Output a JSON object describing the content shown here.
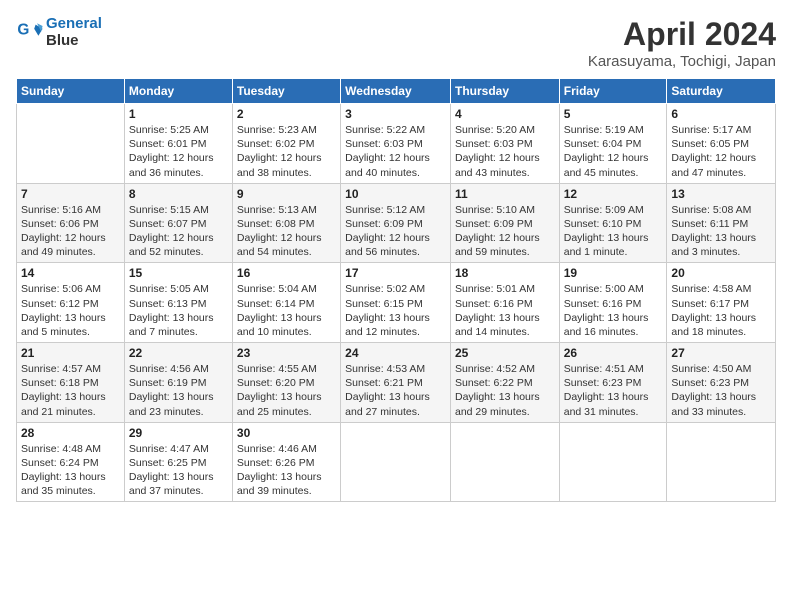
{
  "header": {
    "logo_line1": "General",
    "logo_line2": "Blue",
    "title": "April 2024",
    "subtitle": "Karasuyama, Tochigi, Japan"
  },
  "days_of_week": [
    "Sunday",
    "Monday",
    "Tuesday",
    "Wednesday",
    "Thursday",
    "Friday",
    "Saturday"
  ],
  "weeks": [
    [
      {
        "day": "",
        "info": ""
      },
      {
        "day": "1",
        "info": "Sunrise: 5:25 AM\nSunset: 6:01 PM\nDaylight: 12 hours\nand 36 minutes."
      },
      {
        "day": "2",
        "info": "Sunrise: 5:23 AM\nSunset: 6:02 PM\nDaylight: 12 hours\nand 38 minutes."
      },
      {
        "day": "3",
        "info": "Sunrise: 5:22 AM\nSunset: 6:03 PM\nDaylight: 12 hours\nand 40 minutes."
      },
      {
        "day": "4",
        "info": "Sunrise: 5:20 AM\nSunset: 6:03 PM\nDaylight: 12 hours\nand 43 minutes."
      },
      {
        "day": "5",
        "info": "Sunrise: 5:19 AM\nSunset: 6:04 PM\nDaylight: 12 hours\nand 45 minutes."
      },
      {
        "day": "6",
        "info": "Sunrise: 5:17 AM\nSunset: 6:05 PM\nDaylight: 12 hours\nand 47 minutes."
      }
    ],
    [
      {
        "day": "7",
        "info": "Sunrise: 5:16 AM\nSunset: 6:06 PM\nDaylight: 12 hours\nand 49 minutes."
      },
      {
        "day": "8",
        "info": "Sunrise: 5:15 AM\nSunset: 6:07 PM\nDaylight: 12 hours\nand 52 minutes."
      },
      {
        "day": "9",
        "info": "Sunrise: 5:13 AM\nSunset: 6:08 PM\nDaylight: 12 hours\nand 54 minutes."
      },
      {
        "day": "10",
        "info": "Sunrise: 5:12 AM\nSunset: 6:09 PM\nDaylight: 12 hours\nand 56 minutes."
      },
      {
        "day": "11",
        "info": "Sunrise: 5:10 AM\nSunset: 6:09 PM\nDaylight: 12 hours\nand 59 minutes."
      },
      {
        "day": "12",
        "info": "Sunrise: 5:09 AM\nSunset: 6:10 PM\nDaylight: 13 hours\nand 1 minute."
      },
      {
        "day": "13",
        "info": "Sunrise: 5:08 AM\nSunset: 6:11 PM\nDaylight: 13 hours\nand 3 minutes."
      }
    ],
    [
      {
        "day": "14",
        "info": "Sunrise: 5:06 AM\nSunset: 6:12 PM\nDaylight: 13 hours\nand 5 minutes."
      },
      {
        "day": "15",
        "info": "Sunrise: 5:05 AM\nSunset: 6:13 PM\nDaylight: 13 hours\nand 7 minutes."
      },
      {
        "day": "16",
        "info": "Sunrise: 5:04 AM\nSunset: 6:14 PM\nDaylight: 13 hours\nand 10 minutes."
      },
      {
        "day": "17",
        "info": "Sunrise: 5:02 AM\nSunset: 6:15 PM\nDaylight: 13 hours\nand 12 minutes."
      },
      {
        "day": "18",
        "info": "Sunrise: 5:01 AM\nSunset: 6:16 PM\nDaylight: 13 hours\nand 14 minutes."
      },
      {
        "day": "19",
        "info": "Sunrise: 5:00 AM\nSunset: 6:16 PM\nDaylight: 13 hours\nand 16 minutes."
      },
      {
        "day": "20",
        "info": "Sunrise: 4:58 AM\nSunset: 6:17 PM\nDaylight: 13 hours\nand 18 minutes."
      }
    ],
    [
      {
        "day": "21",
        "info": "Sunrise: 4:57 AM\nSunset: 6:18 PM\nDaylight: 13 hours\nand 21 minutes."
      },
      {
        "day": "22",
        "info": "Sunrise: 4:56 AM\nSunset: 6:19 PM\nDaylight: 13 hours\nand 23 minutes."
      },
      {
        "day": "23",
        "info": "Sunrise: 4:55 AM\nSunset: 6:20 PM\nDaylight: 13 hours\nand 25 minutes."
      },
      {
        "day": "24",
        "info": "Sunrise: 4:53 AM\nSunset: 6:21 PM\nDaylight: 13 hours\nand 27 minutes."
      },
      {
        "day": "25",
        "info": "Sunrise: 4:52 AM\nSunset: 6:22 PM\nDaylight: 13 hours\nand 29 minutes."
      },
      {
        "day": "26",
        "info": "Sunrise: 4:51 AM\nSunset: 6:23 PM\nDaylight: 13 hours\nand 31 minutes."
      },
      {
        "day": "27",
        "info": "Sunrise: 4:50 AM\nSunset: 6:23 PM\nDaylight: 13 hours\nand 33 minutes."
      }
    ],
    [
      {
        "day": "28",
        "info": "Sunrise: 4:48 AM\nSunset: 6:24 PM\nDaylight: 13 hours\nand 35 minutes."
      },
      {
        "day": "29",
        "info": "Sunrise: 4:47 AM\nSunset: 6:25 PM\nDaylight: 13 hours\nand 37 minutes."
      },
      {
        "day": "30",
        "info": "Sunrise: 4:46 AM\nSunset: 6:26 PM\nDaylight: 13 hours\nand 39 minutes."
      },
      {
        "day": "",
        "info": ""
      },
      {
        "day": "",
        "info": ""
      },
      {
        "day": "",
        "info": ""
      },
      {
        "day": "",
        "info": ""
      }
    ]
  ]
}
